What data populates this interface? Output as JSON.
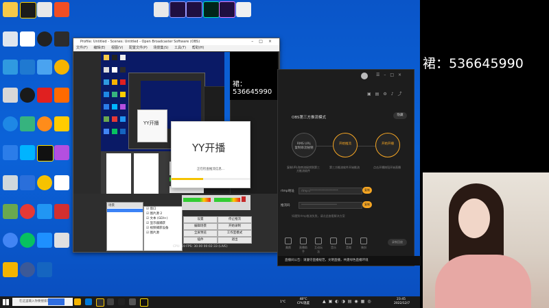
{
  "stream_id": "裙：536645990",
  "preview_id": "裙：536645990",
  "preview_small_id": "536645990",
  "obs": {
    "title": "Profile: Untitled - Scenes: Untitled - Open Broadcaster Software (OBS)",
    "menu": [
      "文件(F)",
      "编辑(E)",
      "视图(V)",
      "配置文件(P)",
      "场景集(S)",
      "工具(T)",
      "帮助(H)"
    ],
    "scenes_header": "场景",
    "sources": [
      "窗口",
      "图片源 2",
      "文本 (GDI+)",
      "显示器捕获",
      "视频捕获设备",
      "图片源"
    ],
    "buttons": [
      "设置",
      "停止推流",
      "编辑场景",
      "开始录制",
      "全屏预览",
      "工作室模式",
      "插件",
      "退出"
    ],
    "status": "CPU: 19  FPS: 30.00  00:02:33 (LIVE)"
  },
  "yy_dialog": {
    "logo": "YY开播",
    "logo_small": "YY开播",
    "message": "正在检查推流信息...",
    "progress": 0.4
  },
  "stream_panel": {
    "title": "OBS第三方推流模式",
    "steps": [
      {
        "label": "RMS URL",
        "sub": "复制串流秘钥",
        "desc": "复制URL和串流秘钥到第三方推流软件",
        "active": false
      },
      {
        "label": "开始推流",
        "sub": "",
        "desc": "第三方推流软件开始推流",
        "active": true
      },
      {
        "label": "开始开播",
        "sub": "",
        "desc": "点击开播按钮开始直播",
        "active": true
      }
    ],
    "hide_btn": "隐藏",
    "rtmp_label": "rtmp地址",
    "rtmp_value": "rtmp://********************",
    "key_label": "推流码",
    "key_value": "**************************",
    "copy_label": "复制",
    "note": "如遇到rtmp推流失败，请点此查看解决方案",
    "tools": [
      "美颜",
      "直播助手",
      "互动玩法",
      "音乐",
      "音效",
      "装扮"
    ],
    "record": "录制回放",
    "notice": "直播间公告：请遵守直播规范，文明直播，共建绿色直播环境"
  },
  "taskbar": {
    "search_placeholder": "在这里输入你要搜索的内容",
    "weather": "1°C",
    "cpu": "48°C CPU温度",
    "time": "23:45",
    "date": "2022/12/7"
  },
  "colors": {
    "desktop": "#0b5fd3",
    "accent": "#f6a623",
    "panel_bg": "#1d1d1d"
  }
}
